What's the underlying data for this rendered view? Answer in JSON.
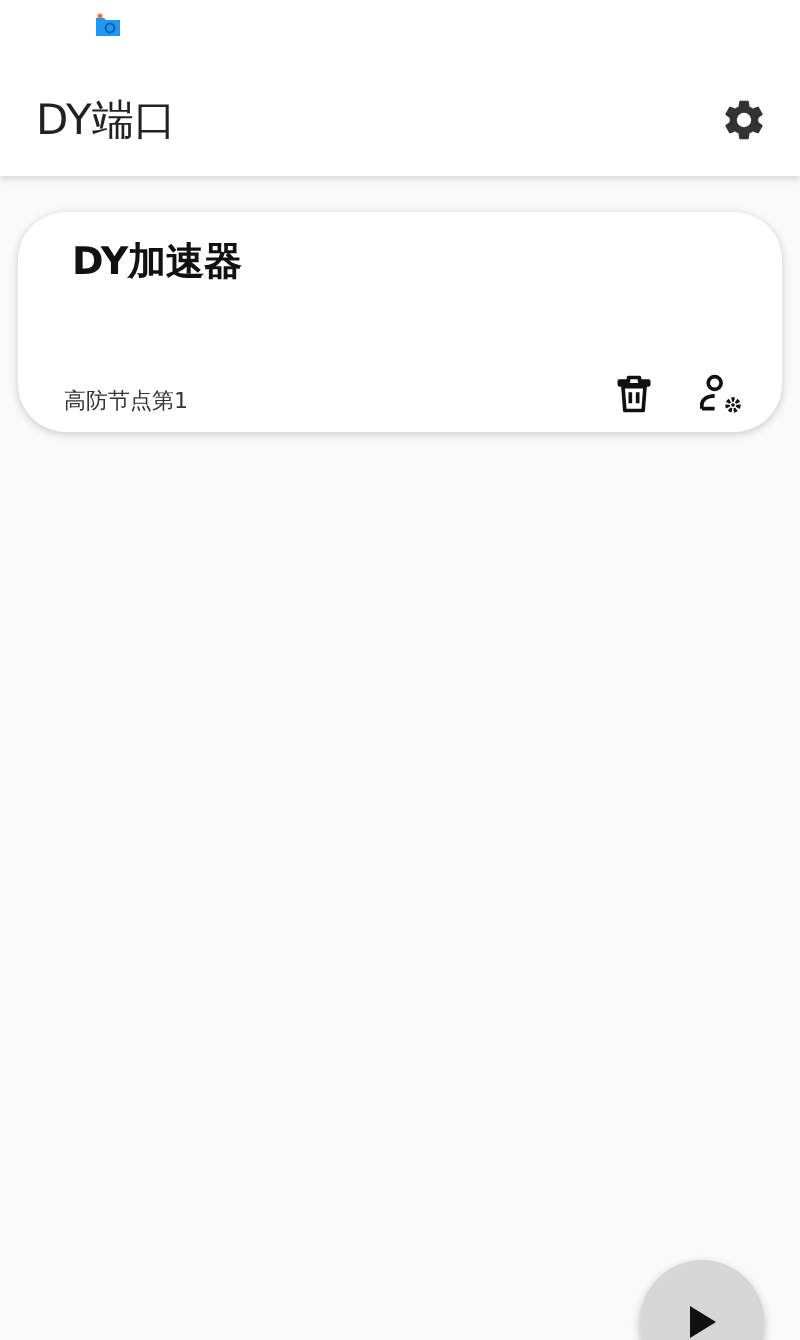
{
  "app_bar": {
    "title": "DY端口"
  },
  "profiles": [
    {
      "name": "DY加速器",
      "subtitle": "高防节点第1"
    }
  ]
}
